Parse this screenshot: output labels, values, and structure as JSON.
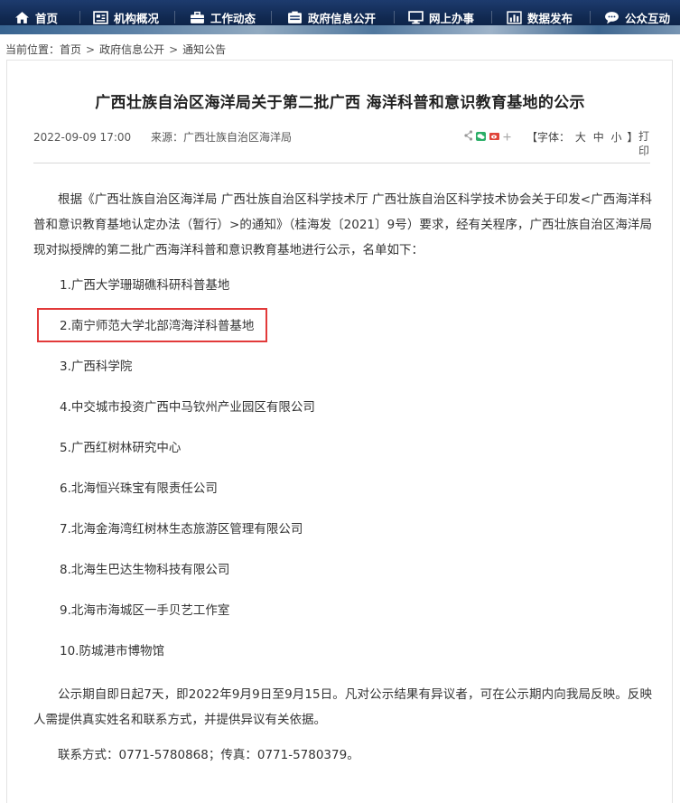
{
  "nav": {
    "items": [
      {
        "label": "首页",
        "icon": "home-icon"
      },
      {
        "label": "机构概况",
        "icon": "org-chart-icon"
      },
      {
        "label": "工作动态",
        "icon": "briefcase-icon"
      },
      {
        "label": "政府信息公开",
        "icon": "info-folder-icon"
      },
      {
        "label": "网上办事",
        "icon": "monitor-icon"
      },
      {
        "label": "数据发布",
        "icon": "bar-chart-icon"
      },
      {
        "label": "公众互动",
        "icon": "speech-bubble-icon"
      }
    ]
  },
  "breadcrumb": {
    "prefix": "当前位置：",
    "items": [
      "首页",
      "政府信息公开",
      "通知公告"
    ],
    "separator": ">"
  },
  "article": {
    "title": "广西壮族自治区海洋局关于第二批广西 海洋科普和意识教育基地的公示",
    "date": "2022-09-09 17:00",
    "source_label": "来源：",
    "source": "广西壮族自治区海洋局",
    "font_size_label_open": "【字体：",
    "font_sizes": [
      "大",
      "中",
      "小"
    ],
    "font_size_label_close": "】",
    "print_label": "打印",
    "intro": "根据《广西壮族自治区海洋局 广西壮族自治区科学技术厅 广西壮族自治区科学技术协会关于印发<广西海洋科普和意识教育基地认定办法（暂行）>的通知》（桂海发〔2021〕9号）要求，经有关程序，广西壮族自治区海洋局现对拟授牌的第二批广西海洋科普和意识教育基地进行公示，名单如下：",
    "list": [
      "1.广西大学珊瑚礁科研科普基地",
      "2.南宁师范大学北部湾海洋科普基地",
      "3.广西科学院",
      "4.中交城市投资广西中马钦州产业园区有限公司",
      "5.广西红树林研究中心",
      "6.北海恒兴珠宝有限责任公司",
      "7.北海金海湾红树林生态旅游区管理有限公司",
      "8.北海生巴达生物科技有限公司",
      "9.北海市海城区一手贝艺工作室",
      "10.防城港市博物馆"
    ],
    "notice": "公示期自即日起7天，即2022年9月9日至9月15日。凡对公示结果有异议者，可在公示期内向我局反映。反映人需提供真实姓名和联系方式，并提供异议有关依据。",
    "contact": "联系方式：0771-5780868；传真：0771-5780379。"
  },
  "colors": {
    "nav_bg": "#10284f",
    "highlight_border": "#e23a3a",
    "wechat_green": "#2aae67",
    "weibo_red": "#e0453a"
  }
}
